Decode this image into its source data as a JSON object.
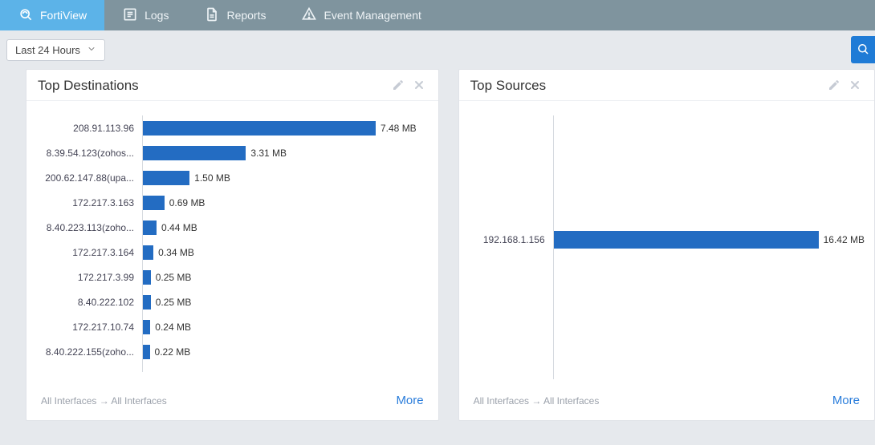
{
  "nav": {
    "tabs": [
      {
        "label": "FortiView",
        "icon": "fortiview"
      },
      {
        "label": "Logs",
        "icon": "logs"
      },
      {
        "label": "Reports",
        "icon": "reports"
      },
      {
        "label": "Event Management",
        "icon": "event"
      }
    ],
    "active_index": 0
  },
  "toolbar": {
    "time_label": "Last 24 Hours"
  },
  "cards": {
    "destinations": {
      "title": "Top Destinations",
      "scope": "All Interfaces → All Interfaces",
      "more": "More"
    },
    "sources": {
      "title": "Top Sources",
      "scope": "All Interfaces → All Interfaces",
      "more": "More"
    }
  },
  "chart_data": [
    {
      "id": "top_destinations",
      "type": "bar",
      "orientation": "horizontal",
      "title": "Top Destinations",
      "xlabel": "",
      "ylabel": "",
      "categories": [
        "208.91.113.96",
        "8.39.54.123(zohos...",
        "200.62.147.88(upa...",
        "172.217.3.163",
        "8.40.223.113(zoho...",
        "172.217.3.164",
        "172.217.3.99",
        "8.40.222.102",
        "172.217.10.74",
        "8.40.222.155(zoho..."
      ],
      "values": [
        7.48,
        3.31,
        1.5,
        0.69,
        0.44,
        0.34,
        0.25,
        0.25,
        0.24,
        0.22
      ],
      "value_labels": [
        "7.48 MB",
        "3.31 MB",
        "1.50 MB",
        "0.69 MB",
        "0.44 MB",
        "0.34 MB",
        "0.25 MB",
        "0.25 MB",
        "0.24 MB",
        "0.22 MB"
      ],
      "unit": "MB",
      "xlim": [
        0,
        7.48
      ]
    },
    {
      "id": "top_sources",
      "type": "bar",
      "orientation": "horizontal",
      "title": "Top Sources",
      "xlabel": "",
      "ylabel": "",
      "categories": [
        "192.168.1.156"
      ],
      "values": [
        16.42
      ],
      "value_labels": [
        "16.42 MB"
      ],
      "unit": "MB",
      "xlim": [
        0,
        16.42
      ]
    }
  ],
  "colors": {
    "bar": "#236cc2",
    "nav_bg": "#7f949e",
    "nav_active": "#5cb3e8",
    "link": "#2a7ddb"
  }
}
